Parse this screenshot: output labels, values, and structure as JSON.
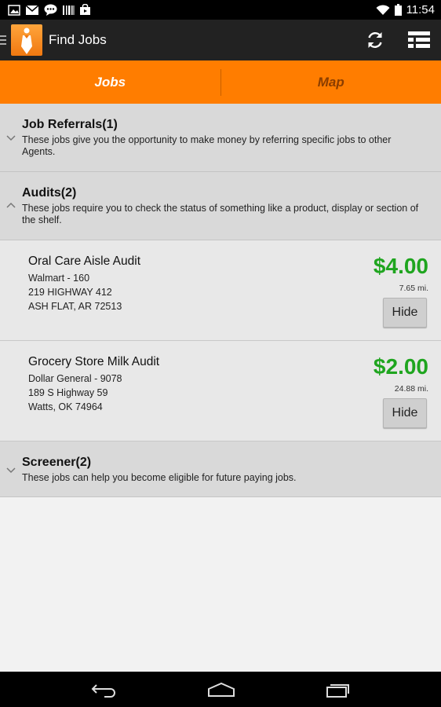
{
  "status_bar": {
    "time": "11:54"
  },
  "action_bar": {
    "title": "Find Jobs"
  },
  "tabs": [
    {
      "label": "Jobs",
      "active": true
    },
    {
      "label": "Map",
      "active": false
    }
  ],
  "sections": {
    "referrals": {
      "title": "Job Referrals(1)",
      "description": "These jobs give you the opportunity to make money by referring specific jobs to other Agents."
    },
    "audits": {
      "title": "Audits(2)",
      "description": "These jobs require you to check the status of something like a product, display or section of the shelf."
    },
    "screener": {
      "title": "Screener(2)",
      "description": "These jobs can help you become eligible for future paying jobs."
    }
  },
  "jobs": [
    {
      "title": "Oral Care Aisle Audit",
      "store": "Walmart - 160",
      "address": "219 HIGHWAY 412",
      "city": "ASH FLAT, AR 72513",
      "price": "$4.00",
      "distance": "7.65 mi.",
      "hide_label": "Hide"
    },
    {
      "title": "Grocery Store Milk Audit",
      "store": "Dollar General - 9078",
      "address": "189 S Highway 59",
      "city": "Watts, OK 74964",
      "price": "$2.00",
      "distance": "24.88 mi.",
      "hide_label": "Hide"
    }
  ],
  "colors": {
    "accent_orange": "#ff7d00",
    "price_green": "#1fa51f",
    "action_bar": "#222222"
  }
}
